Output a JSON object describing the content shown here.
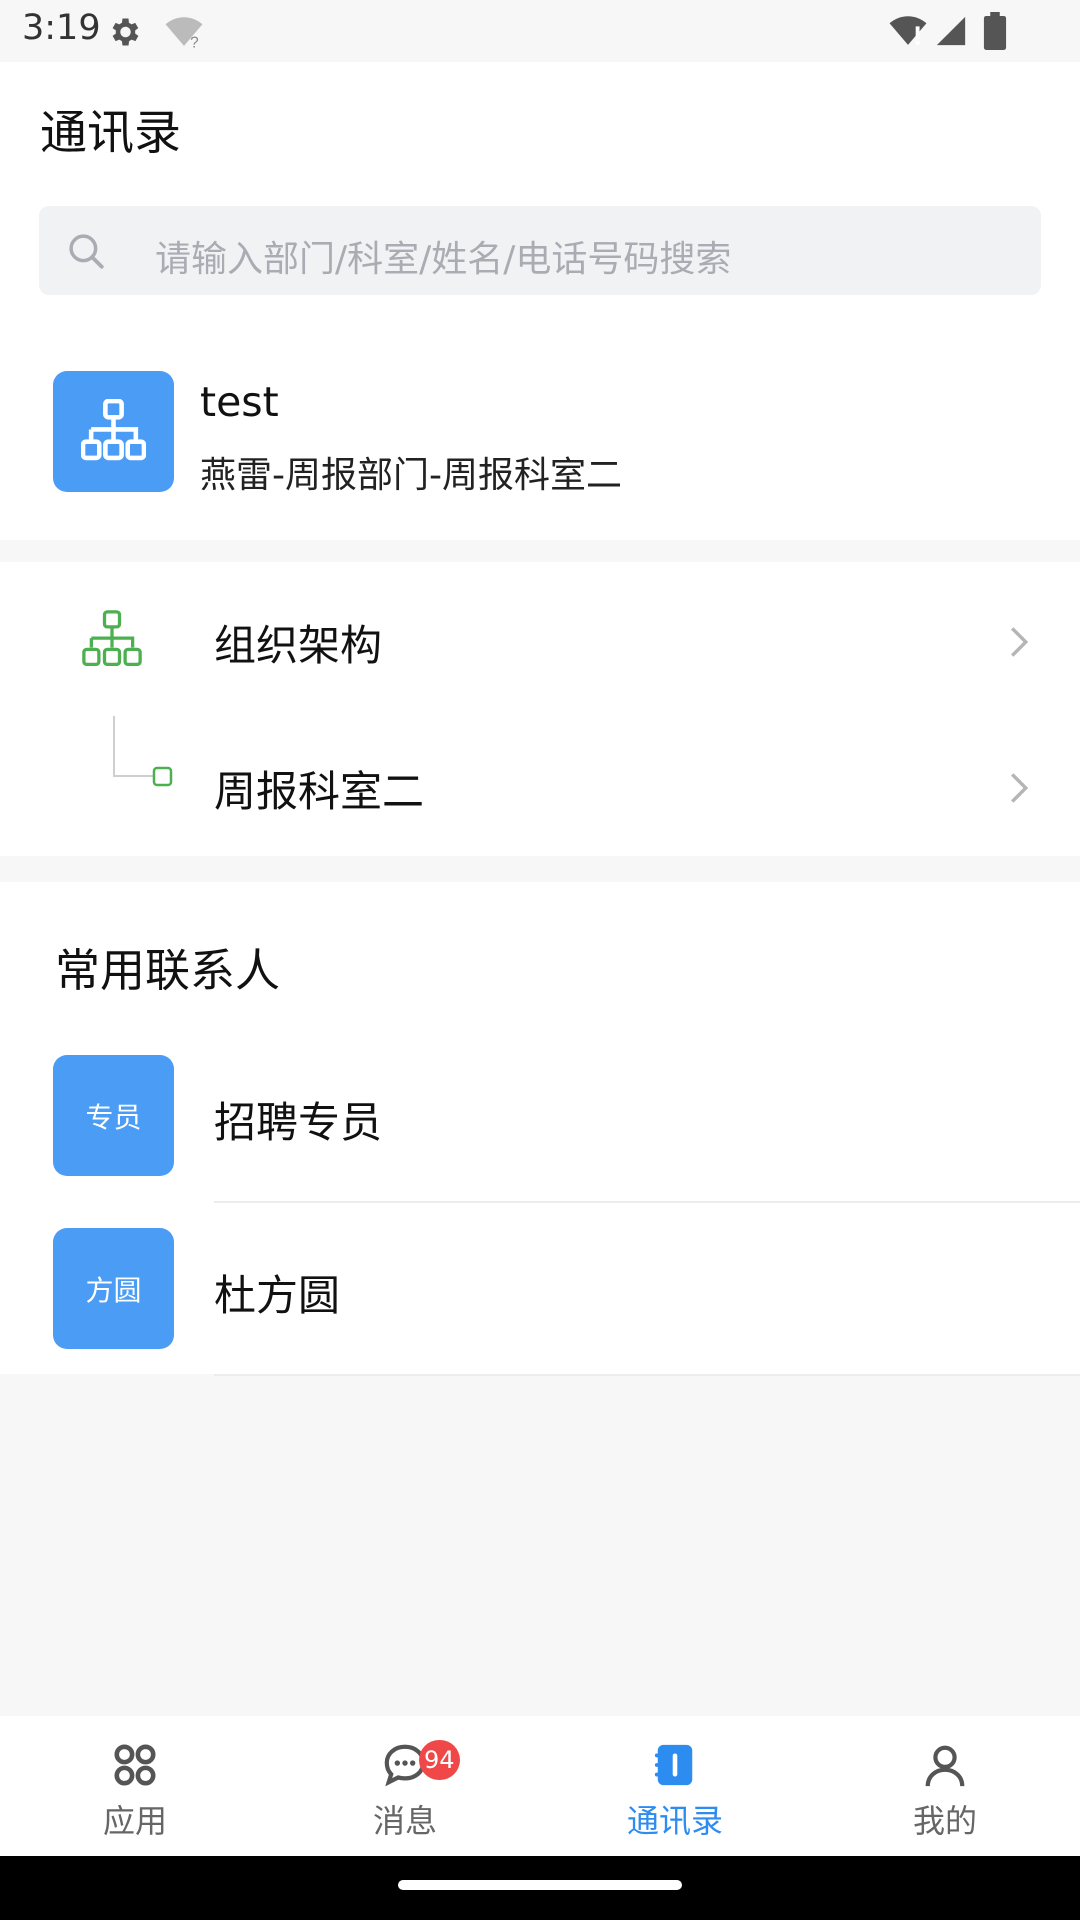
{
  "status_bar": {
    "time": "3:19",
    "icons": [
      "gear-icon",
      "wifi-unknown-icon",
      "wifi-icon",
      "signal-icon",
      "battery-icon"
    ]
  },
  "header": {
    "title": "通讯录"
  },
  "search": {
    "placeholder": "请输入部门/科室/姓名/电话号码搜索"
  },
  "profile": {
    "name": "test",
    "department": "燕雷-周报部门-周报科室二",
    "icon": "org-tree-icon"
  },
  "org": {
    "items": [
      {
        "label": "组织架构",
        "icon": "org-tree-icon"
      },
      {
        "label": "周报科室二",
        "icon": "sub-node-icon"
      }
    ]
  },
  "contacts": {
    "title": "常用联系人",
    "items": [
      {
        "avatar_text": "专员",
        "name": "招聘专员"
      },
      {
        "avatar_text": "方圆",
        "name": "杜方圆"
      }
    ]
  },
  "tabs": {
    "items": [
      {
        "label": "应用",
        "icon": "apps-grid-icon",
        "active": false
      },
      {
        "label": "消息",
        "icon": "chat-bubble-icon",
        "active": false,
        "badge": "94"
      },
      {
        "label": "通讯录",
        "icon": "contacts-book-icon",
        "active": true
      },
      {
        "label": "我的",
        "icon": "person-icon",
        "active": false
      }
    ]
  },
  "colors": {
    "accent": "#2d8cf0",
    "avatar_blue": "#4a9cf5",
    "org_green": "#4caf50",
    "badge_red": "#f04848"
  }
}
